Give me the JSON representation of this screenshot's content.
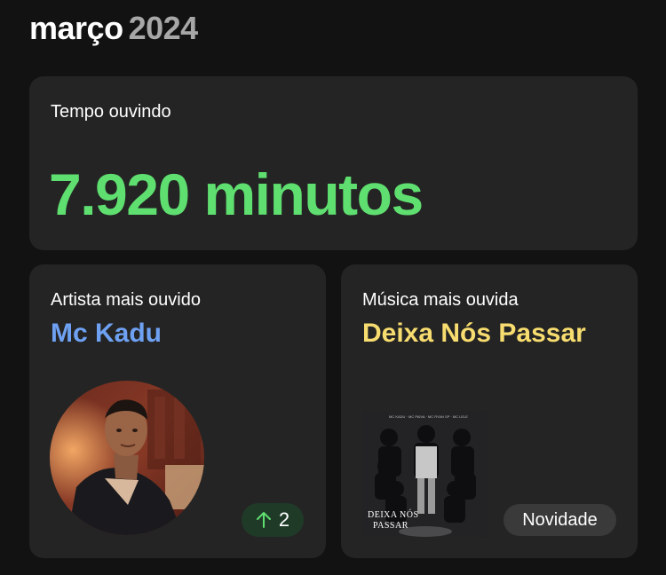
{
  "header": {
    "month": "março",
    "year": "2024"
  },
  "listening_time": {
    "label": "Tempo ouvindo",
    "value": "7.920 minutos"
  },
  "top_artist": {
    "label": "Artista mais ouvido",
    "name": "Mc Kadu",
    "rank_change": "2",
    "rank_change_direction": "up"
  },
  "top_song": {
    "label": "Música mais ouvida",
    "title": "Deixa Nós Passar",
    "badge": "Novidade",
    "cover_text": "DEIXA NÓS PASSAR"
  },
  "colors": {
    "background": "#121212",
    "card": "#242424",
    "minutes_green": "#5fdf70",
    "artist_blue": "#6ea1f2",
    "song_yellow": "#f7dc6f",
    "rank_badge_bg": "#1f3b28",
    "rank_arrow": "#5fdf70",
    "new_badge_bg": "#3a3a3a"
  }
}
